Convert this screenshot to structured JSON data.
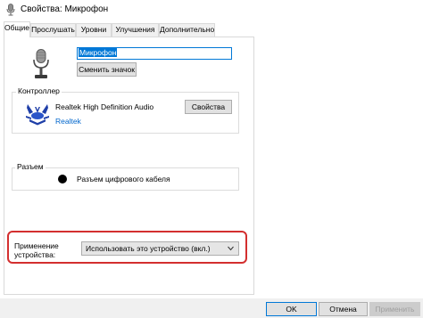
{
  "window": {
    "title": "Свойства: Микрофон",
    "icon": "microphone-icon"
  },
  "tabs": [
    {
      "label": "Общие",
      "active": true
    },
    {
      "label": "Прослушать",
      "active": false
    },
    {
      "label": "Уровни",
      "active": false
    },
    {
      "label": "Улучшения",
      "active": false
    },
    {
      "label": "Дополнительно",
      "active": false
    }
  ],
  "general": {
    "device_icon": "microphone-icon",
    "name_value": "Микрофон",
    "change_icon_label": "Сменить значок"
  },
  "controller": {
    "group_label": "Контроллер",
    "icon": "realtek-logo",
    "device_name": "Realtek High Definition Audio",
    "vendor_link": "Realtek",
    "properties_label": "Свойства"
  },
  "jack": {
    "group_label": "Разъем",
    "jack_color": "#000000",
    "jack_name": "Разъем цифрового кабеля"
  },
  "usage": {
    "label": "Применение устройства:",
    "selected": "Использовать это устройство (вкл.)"
  },
  "footer": {
    "ok_label": "OK",
    "cancel_label": "Отмена",
    "apply_label": "Применить"
  },
  "colors": {
    "accent": "#0078d7",
    "highlight": "#d32f2f"
  }
}
